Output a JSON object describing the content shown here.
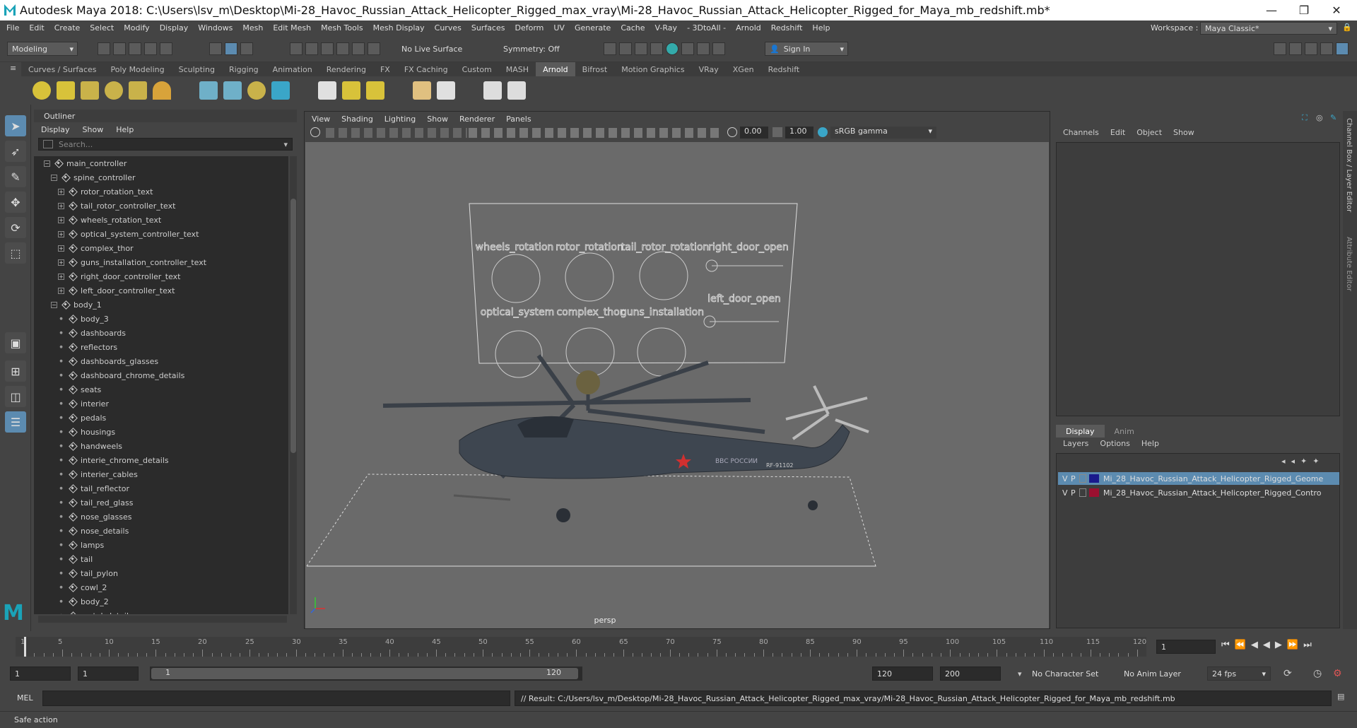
{
  "window": {
    "title": "Autodesk Maya 2018: C:\\Users\\lsv_m\\Desktop\\Mi-28_Havoc_Russian_Attack_Helicopter_Rigged_max_vray\\Mi-28_Havoc_Russian_Attack_Helicopter_Rigged_for_Maya_mb_redshift.mb*",
    "minimize": "—",
    "restore": "❐",
    "close": "✕"
  },
  "menubar": [
    "File",
    "Edit",
    "Create",
    "Select",
    "Modify",
    "Display",
    "Windows",
    "Mesh",
    "Edit Mesh",
    "Mesh Tools",
    "Mesh Display",
    "Curves",
    "Surfaces",
    "Deform",
    "UV",
    "Generate",
    "Cache",
    "V-Ray",
    "- 3DtoAll -",
    "Arnold",
    "Redshift",
    "Help"
  ],
  "workspace": {
    "label": "Workspace :",
    "value": "Maya Classic*"
  },
  "statusline": {
    "mode": "Modeling",
    "live_surface": "No Live Surface",
    "symmetry": "Symmetry: Off",
    "sign_in": "Sign In"
  },
  "shelf_tabs": [
    "Curves / Surfaces",
    "Poly Modeling",
    "Sculpting",
    "Rigging",
    "Animation",
    "Rendering",
    "FX",
    "FX Caching",
    "Custom",
    "MASH",
    "Arnold",
    "Bifrost",
    "Motion Graphics",
    "VRay",
    "XGen",
    "Redshift"
  ],
  "active_shelf": "Arnold",
  "outliner": {
    "title": "Outliner",
    "menu": [
      "Display",
      "Show",
      "Help"
    ],
    "search_placeholder": "Search...",
    "items": [
      {
        "label": "main_controller",
        "depth": 0,
        "expander": "minus"
      },
      {
        "label": "spine_controller",
        "depth": 1,
        "expander": "minus"
      },
      {
        "label": "rotor_rotation_text",
        "depth": 2,
        "expander": "plus"
      },
      {
        "label": "tail_rotor_controller_text",
        "depth": 2,
        "expander": "plus"
      },
      {
        "label": "wheels_rotation_text",
        "depth": 2,
        "expander": "plus"
      },
      {
        "label": "optical_system_controller_text",
        "depth": 2,
        "expander": "plus"
      },
      {
        "label": "complex_thor",
        "depth": 2,
        "expander": "plus"
      },
      {
        "label": "guns_installation_controller_text",
        "depth": 2,
        "expander": "plus"
      },
      {
        "label": "right_door_controller_text",
        "depth": 2,
        "expander": "plus"
      },
      {
        "label": "left_door_controller_text",
        "depth": 2,
        "expander": "plus"
      },
      {
        "label": "body_1",
        "depth": 1,
        "expander": "minus"
      },
      {
        "label": "body_3",
        "depth": 2,
        "expander": "dot"
      },
      {
        "label": "dashboards",
        "depth": 2,
        "expander": "dot"
      },
      {
        "label": "reflectors",
        "depth": 2,
        "expander": "dot"
      },
      {
        "label": "dashboards_glasses",
        "depth": 2,
        "expander": "dot"
      },
      {
        "label": "dashboard_chrome_details",
        "depth": 2,
        "expander": "dot"
      },
      {
        "label": "seats",
        "depth": 2,
        "expander": "dot"
      },
      {
        "label": "interier",
        "depth": 2,
        "expander": "dot"
      },
      {
        "label": "pedals",
        "depth": 2,
        "expander": "dot"
      },
      {
        "label": "housings",
        "depth": 2,
        "expander": "dot"
      },
      {
        "label": "handweels",
        "depth": 2,
        "expander": "dot"
      },
      {
        "label": "interie_chrome_details",
        "depth": 2,
        "expander": "dot"
      },
      {
        "label": "interier_cables",
        "depth": 2,
        "expander": "dot"
      },
      {
        "label": "tail_reflector",
        "depth": 2,
        "expander": "dot"
      },
      {
        "label": "tail_red_glass",
        "depth": 2,
        "expander": "dot"
      },
      {
        "label": "nose_glasses",
        "depth": 2,
        "expander": "dot"
      },
      {
        "label": "nose_details",
        "depth": 2,
        "expander": "dot"
      },
      {
        "label": "lamps",
        "depth": 2,
        "expander": "dot"
      },
      {
        "label": "tail",
        "depth": 2,
        "expander": "dot"
      },
      {
        "label": "tail_pylon",
        "depth": 2,
        "expander": "dot"
      },
      {
        "label": "cowl_2",
        "depth": 2,
        "expander": "dot"
      },
      {
        "label": "body_2",
        "depth": 2,
        "expander": "dot"
      },
      {
        "label": "metal_details",
        "depth": 2,
        "expander": "dot"
      }
    ]
  },
  "viewport": {
    "menu": [
      "View",
      "Shading",
      "Lighting",
      "Show",
      "Renderer",
      "Panels"
    ],
    "exposure": "0.00",
    "gamma": "1.00",
    "color_space": "sRGB gamma",
    "camera_label": "persp",
    "controls_board": {
      "top_labels": [
        "wheels_rotation",
        "rotor_rotation",
        "tail_rotor_rotation",
        "right_door_open"
      ],
      "bottom_labels": [
        "optical_system",
        "complex_thor",
        "guns_installation",
        "left_door_open"
      ]
    },
    "fuselage_text": [
      "ВВС РОССИИ",
      "RF-91102"
    ]
  },
  "channel_box": {
    "menu": [
      "Channels",
      "Edit",
      "Object",
      "Show"
    ]
  },
  "side_tabs": [
    "Channel Box / Layer Editor",
    "Attribute Editor"
  ],
  "layer_editor": {
    "tabs": [
      "Display",
      "Anim"
    ],
    "menu": [
      "Layers",
      "Options",
      "Help"
    ],
    "layers": [
      {
        "v": "V",
        "p": "P",
        "color": "#1a1a8c",
        "name": "Mi_28_Havoc_Russian_Attack_Helicopter_Rigged_Geome",
        "selected": true
      },
      {
        "v": "V",
        "p": "P",
        "color": "#9b1030",
        "name": "Mi_28_Havoc_Russian_Attack_Helicopter_Rigged_Contro",
        "selected": false
      }
    ]
  },
  "timeline": {
    "ticks": [
      "1",
      "5",
      "10",
      "15",
      "20",
      "25",
      "30",
      "35",
      "40",
      "45",
      "50",
      "55",
      "60",
      "65",
      "70",
      "75",
      "80",
      "85",
      "90",
      "95",
      "100",
      "105",
      "110",
      "115",
      "120"
    ],
    "current_frame": "1"
  },
  "range": {
    "start": "1",
    "playback_start": "1",
    "slider_start": "1",
    "slider_end": "120",
    "playback_end": "120",
    "end": "200",
    "character_set": "No Character Set",
    "anim_layer": "No Anim Layer",
    "fps": "24 fps"
  },
  "command_line": {
    "lang": "MEL",
    "result": "// Result: C:/Users/lsv_m/Desktop/Mi-28_Havoc_Russian_Attack_Helicopter_Rigged_max_vray/Mi-28_Havoc_Russian_Attack_Helicopter_Rigged_for_Maya_mb_redshift.mb"
  },
  "help_line": "Safe action",
  "colors": {
    "accent": "#5c8bb0",
    "viewport_bg": "#6a6a6a",
    "panel_bg": "#444444"
  }
}
